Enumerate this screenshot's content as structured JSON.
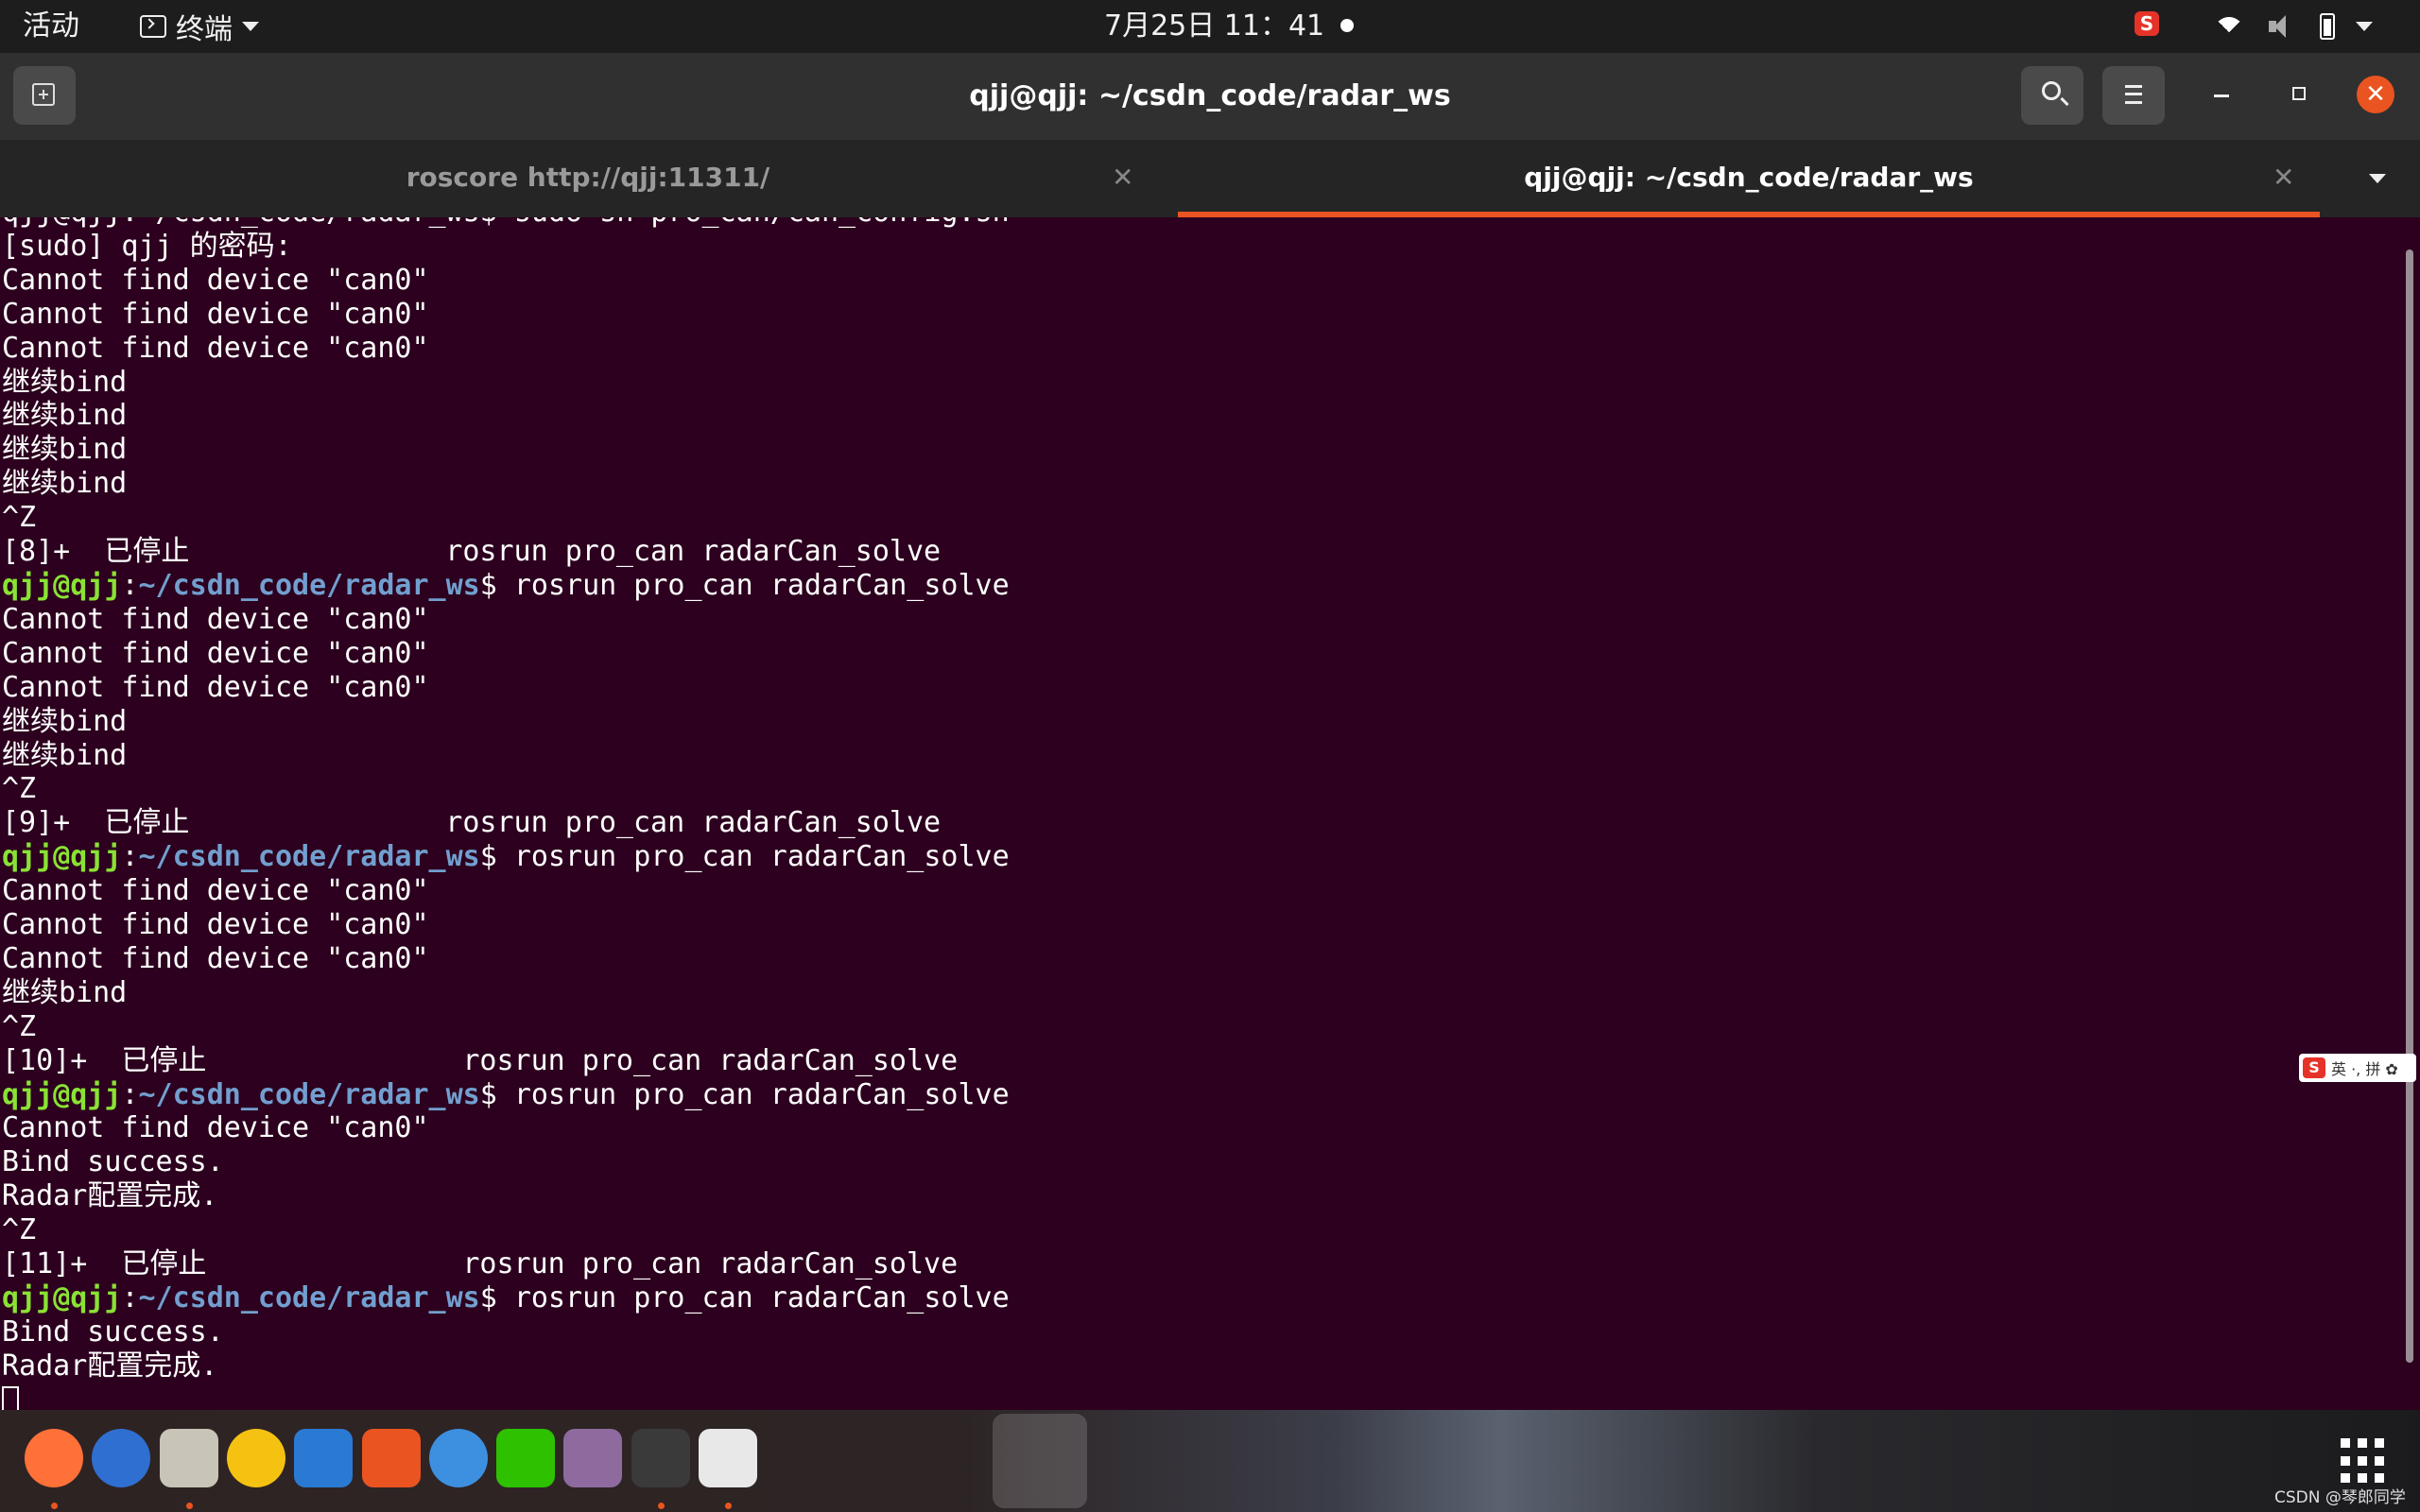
{
  "topbar": {
    "activities": "活动",
    "app_name": "终端",
    "clock": "7月25日  11：41",
    "ime_badge": "S"
  },
  "window": {
    "title": "qjj@qjj: ~/csdn_code/radar_ws"
  },
  "tabs": [
    {
      "label": "roscore http://qjj:11311/",
      "active": false
    },
    {
      "label": "qjj@qjj: ~/csdn_code/radar_ws",
      "active": true
    }
  ],
  "prompt": {
    "user": "qjj@qjj",
    "path": "~/csdn_code/radar_ws"
  },
  "terminal": {
    "clipped_top_line": "qjj@qjj:~/csdn_code/radar_ws$ sudo sh pro_can/can_config.sh",
    "lines": [
      "[sudo] qjj 的密码:",
      "Cannot find device \"can0\"",
      "Cannot find device \"can0\"",
      "Cannot find device \"can0\"",
      "继续bind",
      "继续bind",
      "继续bind",
      "继续bind",
      "^Z",
      "[8]+  已停止               rosrun pro_can radarCan_solve",
      {
        "prompt": true,
        "cmd": "$ rosrun pro_can radarCan_solve"
      },
      "Cannot find device \"can0\"",
      "Cannot find device \"can0\"",
      "Cannot find device \"can0\"",
      "继续bind",
      "继续bind",
      "^Z",
      "[9]+  已停止               rosrun pro_can radarCan_solve",
      {
        "prompt": true,
        "cmd": "$ rosrun pro_can radarCan_solve"
      },
      "Cannot find device \"can0\"",
      "Cannot find device \"can0\"",
      "Cannot find device \"can0\"",
      "继续bind",
      "^Z",
      "[10]+  已停止               rosrun pro_can radarCan_solve",
      {
        "prompt": true,
        "cmd": "$ rosrun pro_can radarCan_solve"
      },
      "Cannot find device \"can0\"",
      "Bind success.",
      "Radar配置完成.",
      "^Z",
      "[11]+  已停止               rosrun pro_can radarCan_solve",
      {
        "prompt": true,
        "cmd": "$ rosrun pro_can radarCan_solve"
      },
      "Bind success.",
      "Radar配置完成."
    ]
  },
  "ime_toolbar": {
    "badge": "S",
    "text": "英 ·, 拼 ✿"
  },
  "dock": {
    "apps": [
      {
        "name": "firefox",
        "color": "#ff7139",
        "running": true
      },
      {
        "name": "thunderbird",
        "color": "#2f6fd1",
        "running": false
      },
      {
        "name": "files",
        "color": "#c9c4b8",
        "running": true
      },
      {
        "name": "rhythmbox",
        "color": "#f5c211",
        "running": false
      },
      {
        "name": "libreoffice-writer",
        "color": "#2a7ad3",
        "running": false
      },
      {
        "name": "ubuntu-software",
        "color": "#e95420",
        "running": false
      },
      {
        "name": "help",
        "color": "#3d8fe0",
        "running": false
      },
      {
        "name": "wechat",
        "color": "#2dc100",
        "running": false
      },
      {
        "name": "video",
        "color": "#8e6a9e",
        "running": false
      },
      {
        "name": "terminal",
        "color": "#3a3a3a",
        "running": true
      },
      {
        "name": "text-editor",
        "color": "#e8e8e8",
        "running": true
      }
    ]
  },
  "watermark": "CSDN @琴郎同学"
}
